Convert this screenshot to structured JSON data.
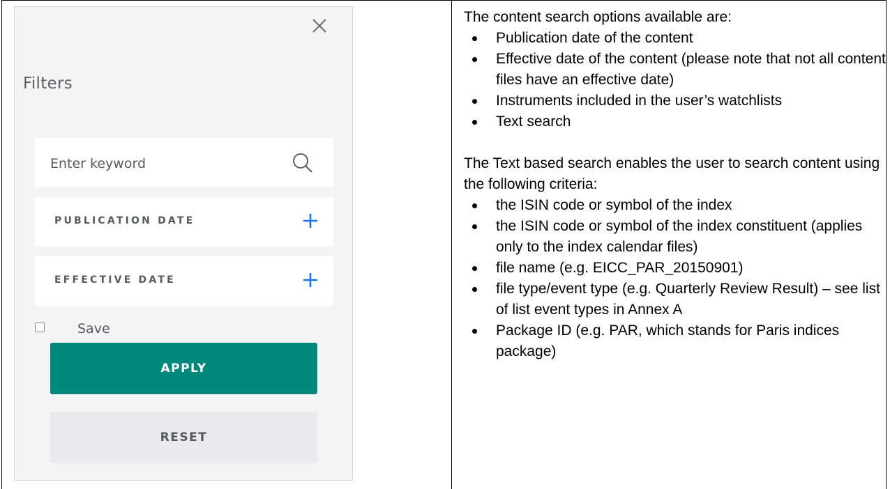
{
  "filter_panel": {
    "title": "Filters",
    "search": {
      "placeholder": "Enter keyword",
      "value": ""
    },
    "publication_date_label": "PUBLICATION DATE",
    "effective_date_label": "EFFECTIVE DATE",
    "save_label": "Save",
    "save_checked": false,
    "apply_label": "APPLY",
    "reset_label": "RESET",
    "icons": [
      "close-icon",
      "search-icon",
      "plus-icon"
    ],
    "colors": {
      "apply": "#00897b",
      "plus": "#1a73e8",
      "panel_bg": "#f4f4f4"
    }
  },
  "description": {
    "intro": "The content search options available are:",
    "search_options": [
      "Publication date of the content",
      "Effective date of the content (please note that not all content files have an effective date)",
      "Instruments included in the user’s watchlists",
      "Text search"
    ],
    "text_search_intro": "The Text based search enables the user to search content using the following criteria:",
    "criteria": [
      "the ISIN code or symbol of the index",
      "the ISIN code or symbol of the index constituent (applies only to the index calendar files)",
      "file name (e.g. EICC_PAR_20150901)",
      "file type/event type (e.g. Quarterly Review Result) – see list of list event types in Annex A",
      "Package ID  (e.g. PAR, which stands for Paris indices package)"
    ]
  }
}
